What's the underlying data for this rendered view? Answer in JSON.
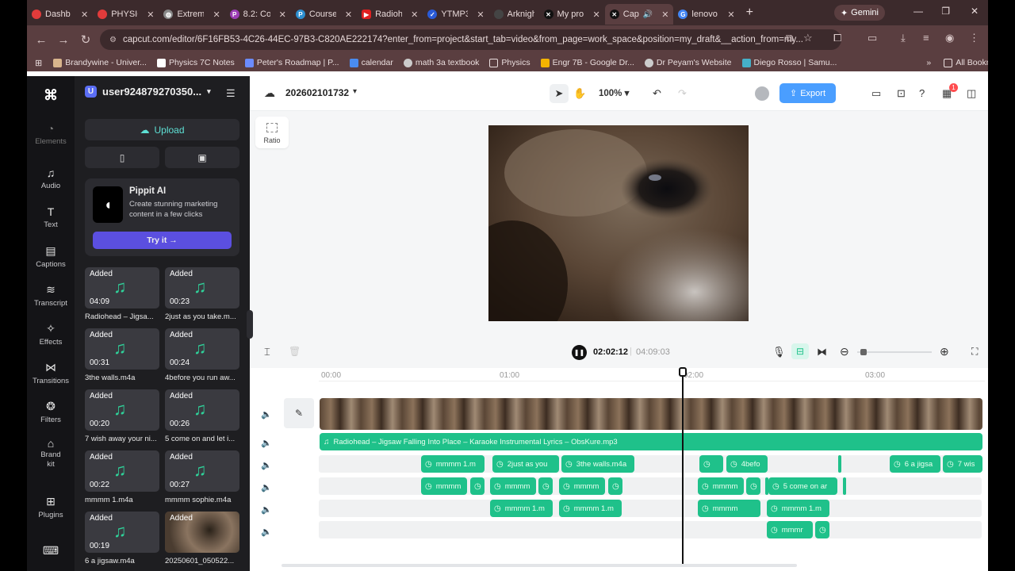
{
  "browser": {
    "tabs": [
      {
        "label": "Dashb",
        "icon": "app-icon",
        "color": "#e23b3b"
      },
      {
        "label": "PHYSIC",
        "icon": "app-icon",
        "color": "#e23b3b"
      },
      {
        "label": "Extrem",
        "icon": "globe-icon",
        "color": "#888888"
      },
      {
        "label": "8.2: Co",
        "icon": "p-icon",
        "color": "#9b3db5"
      },
      {
        "label": "Course",
        "icon": "p-icon",
        "color": "#2d8fd0"
      },
      {
        "label": "Radioh",
        "icon": "youtube-icon",
        "color": "#e02020"
      },
      {
        "label": "YTMP3",
        "icon": "shield-icon",
        "color": "#2a5bd7"
      },
      {
        "label": "Arknigh",
        "icon": "app-icon",
        "color": "#444444"
      },
      {
        "label": "My pro",
        "icon": "capcut-icon",
        "color": "#111111"
      },
      {
        "label": "Cap",
        "icon": "capcut-icon",
        "color": "#111111",
        "active": true
      },
      {
        "label": "lenovo",
        "icon": "google-icon",
        "color": "#4285f4"
      }
    ],
    "gemini_label": "Gemini",
    "url": "capcut.com/editor/6F16FB53-4C26-44EC-97B3-C820AE222174?enter_from=project&start_tab=video&from_page=work_space&position=my_draft&__action_from=my...",
    "bookmarks": [
      "Brandywine - Univer...",
      "Physics 7C Notes",
      "Peter's Roadmap | P...",
      "calendar",
      "math 3a textbook",
      "Physics",
      "Engr 7B - Google Dr...",
      "Dr Peyam's Website",
      "Diego Rosso | Samu..."
    ],
    "all_bookmarks_label": "All Bookmarks"
  },
  "leftnav": [
    {
      "label": "Elements",
      "icon": "elements-icon"
    },
    {
      "label": "Audio",
      "icon": "audio-icon"
    },
    {
      "label": "Text",
      "icon": "text-icon"
    },
    {
      "label": "Captions",
      "icon": "captions-icon"
    },
    {
      "label": "Transcript",
      "icon": "transcript-icon"
    },
    {
      "label": "Effects",
      "icon": "effects-icon"
    },
    {
      "label": "Transitions",
      "icon": "transitions-icon"
    },
    {
      "label": "Filters",
      "icon": "filters-icon"
    },
    {
      "label": "Brand kit",
      "icon": "brand-kit-icon"
    },
    {
      "label": "Plugins",
      "icon": "plugins-icon"
    }
  ],
  "panel": {
    "account": "user924879270350...",
    "upload_label": "Upload",
    "pippit": {
      "title": "Pippit AI",
      "desc": "Create stunning marketing content in a few clicks",
      "button": "Try it →"
    },
    "added_label": "Added",
    "assets": [
      {
        "duration": "04:09",
        "name": "Radiohead – Jigsa..."
      },
      {
        "duration": "00:23",
        "name": "2just as you take.m..."
      },
      {
        "duration": "00:31",
        "name": "3the walls.m4a"
      },
      {
        "duration": "00:24",
        "name": "4before you run aw..."
      },
      {
        "duration": "00:20",
        "name": "7 wish away your ni..."
      },
      {
        "duration": "00:26",
        "name": "5 come on and let i..."
      },
      {
        "duration": "00:22",
        "name": "mmmm 1.m4a"
      },
      {
        "duration": "00:27",
        "name": "mmmm sophie.m4a"
      },
      {
        "duration": "00:19",
        "name": "6 a jigsaw.m4a"
      },
      {
        "duration": "",
        "name": "20250601_050522..."
      }
    ]
  },
  "editor": {
    "project_name": "202602101732",
    "zoom": "100%",
    "export_label": "Export",
    "ratio_label": "Ratio",
    "current_time": "02:02:12",
    "total_time": "04:09:03",
    "notification_badge": "1",
    "ruler": [
      "00:00",
      "01:00",
      "02:00",
      "03:00"
    ],
    "audio_track_label": "Radiohead – Jigsaw Falling Into Place – Karaoke Instrumental Lyrics – ObsKure.mp3",
    "clips_row1": [
      "mmmm 1.m",
      "2just as you",
      "3the walls.m4a",
      "",
      "4befo",
      "",
      "6 a jigsa",
      "7 wis"
    ],
    "clips_row2": [
      "mmmm",
      "",
      "mmmm",
      "",
      "mmmm",
      "",
      "mmmm",
      "",
      "",
      "5 come on ar",
      ""
    ],
    "clips_row3": [
      "mmmm 1.m",
      "mmmm 1.m",
      "mmmm",
      "mmmm 1.m"
    ],
    "clips_row4": [
      "mmmr",
      ""
    ]
  },
  "colors": {
    "accent": "#1fc18a",
    "export": "#4a9eff",
    "pippit_button": "#5b4fe0"
  }
}
